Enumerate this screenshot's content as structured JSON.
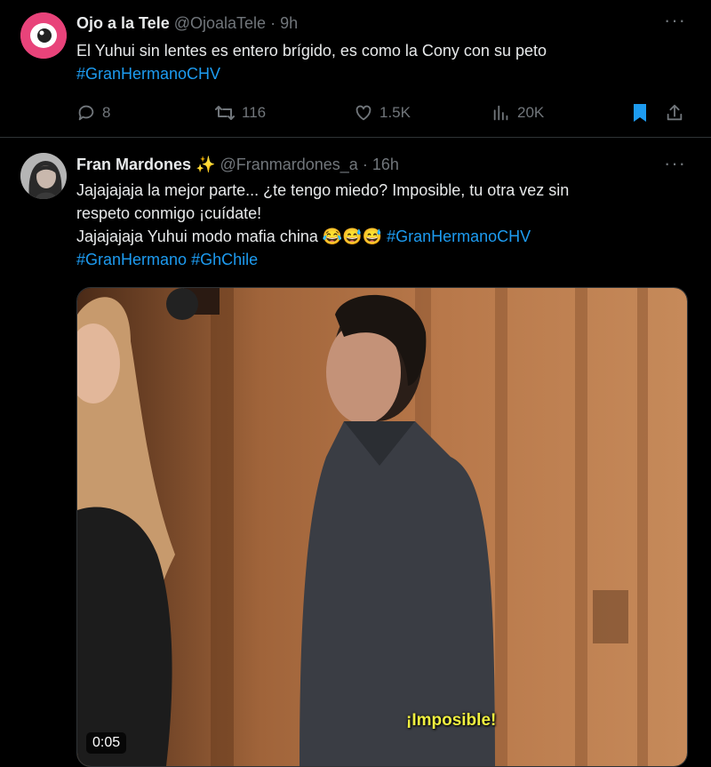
{
  "tweet1": {
    "display_name": "Ojo a la Tele",
    "handle": "@OjoalaTele",
    "separator": "·",
    "time": "9h",
    "text_line1": "El Yuhui sin lentes es entero brígido, es como la Cony con su peto",
    "hashtag": "#GranHermanoCHV",
    "replies": "8",
    "reposts": "116",
    "likes": "1.5K",
    "views": "20K",
    "more": "···",
    "avatar_color": "#e8437a",
    "bookmark_color": "#1d9bf0"
  },
  "tweet2": {
    "display_name": "Fran Mardones ✨",
    "handle": "@Franmardones_a",
    "separator": "·",
    "time": "16h",
    "line1": "Jajajajaja la mejor parte... ¿te tengo miedo? Imposible, tu otra vez sin",
    "line2": "respeto conmigo ¡cuídate!",
    "line3_text": "Jajajajaja Yuhui modo mafia china 😂😅😅 ",
    "line3_hashtag": "#GranHermanoCHV",
    "line4_hashtag1": "#GranHermano",
    "line4_hashtag2": "#GhChile",
    "more": "···",
    "video_caption": "¡Imposible!",
    "video_duration": "0:05"
  }
}
